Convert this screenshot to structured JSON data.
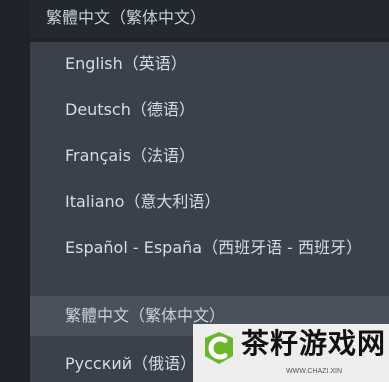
{
  "current_selection": {
    "label": "繁體中文（繁体中文）"
  },
  "dropdown": {
    "options": [
      {
        "label": "English（英语）"
      },
      {
        "label": "Deutsch（德语）"
      },
      {
        "label": "Français（法语）"
      },
      {
        "label": "Italiano（意大利语）"
      },
      {
        "label": "Español - España（西班牙语 - 西班牙）"
      },
      {
        "label": "繁體中文（繁体中文）"
      },
      {
        "label": "Русский（俄语）"
      }
    ],
    "selected_label": "繁體中文（繁体中文）"
  },
  "watermark": {
    "title": "茶籽游戏网",
    "url": "WWW.CHAZI.XIN"
  },
  "colors": {
    "background": "#1f2329",
    "dropdown_bg": "#3b414b",
    "selected_bg": "#4a515c",
    "text": "#d5dce2",
    "logo_green": "#68b829"
  }
}
